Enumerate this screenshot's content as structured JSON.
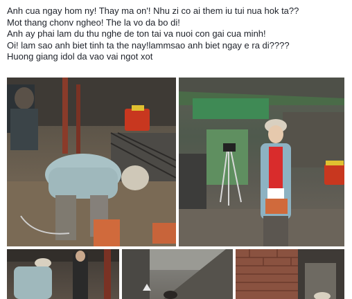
{
  "post": {
    "lines": [
      "Anh cua ngay hom ny! Thay ma on'! Nhu zi co ai them iu tui nua hok ta??",
      "Mot thang chonv ngheo! The la vo da bo di!",
      "Anh ay phai lam du thu nghe de ton tai va nuoi con gai cua minh!",
      "Oi! lam sao anh biet tinh ta the nay!lammsao anh biet ngay e ra di????",
      "Huong giang idol da vao vai ngot xot"
    ]
  },
  "colors": {
    "text": "#1d2129",
    "background": "#ffffff"
  }
}
